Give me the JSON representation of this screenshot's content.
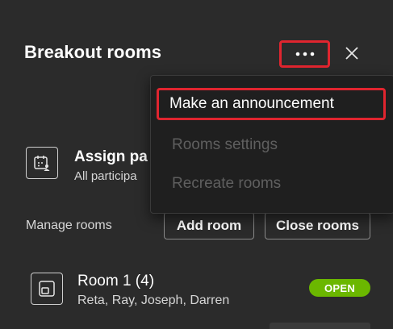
{
  "header": {
    "title": "Breakout rooms",
    "more_icon": "more-horizontal-icon",
    "close_icon": "close-icon"
  },
  "menu": {
    "items": [
      {
        "label": "Make an announcement",
        "enabled": true,
        "highlighted": true
      },
      {
        "label": "Rooms settings",
        "enabled": false
      },
      {
        "label": "Recreate rooms",
        "enabled": false
      }
    ]
  },
  "assign": {
    "icon": "calendar-people-icon",
    "title": "Assign pa",
    "subtitle": "All participa"
  },
  "manage": {
    "label": "Manage rooms",
    "add_room": "Add room",
    "close_rooms": "Close rooms"
  },
  "rooms": [
    {
      "icon": "room-icon",
      "name": "Room 1 (4)",
      "members": "Reta, Ray, Joseph, Darren",
      "status": "OPEN"
    }
  ],
  "colors": {
    "background": "#2b2b2b",
    "menu_background": "#1f1f1f",
    "highlight_border": "#e0252f",
    "open_badge": "#6bb700"
  }
}
